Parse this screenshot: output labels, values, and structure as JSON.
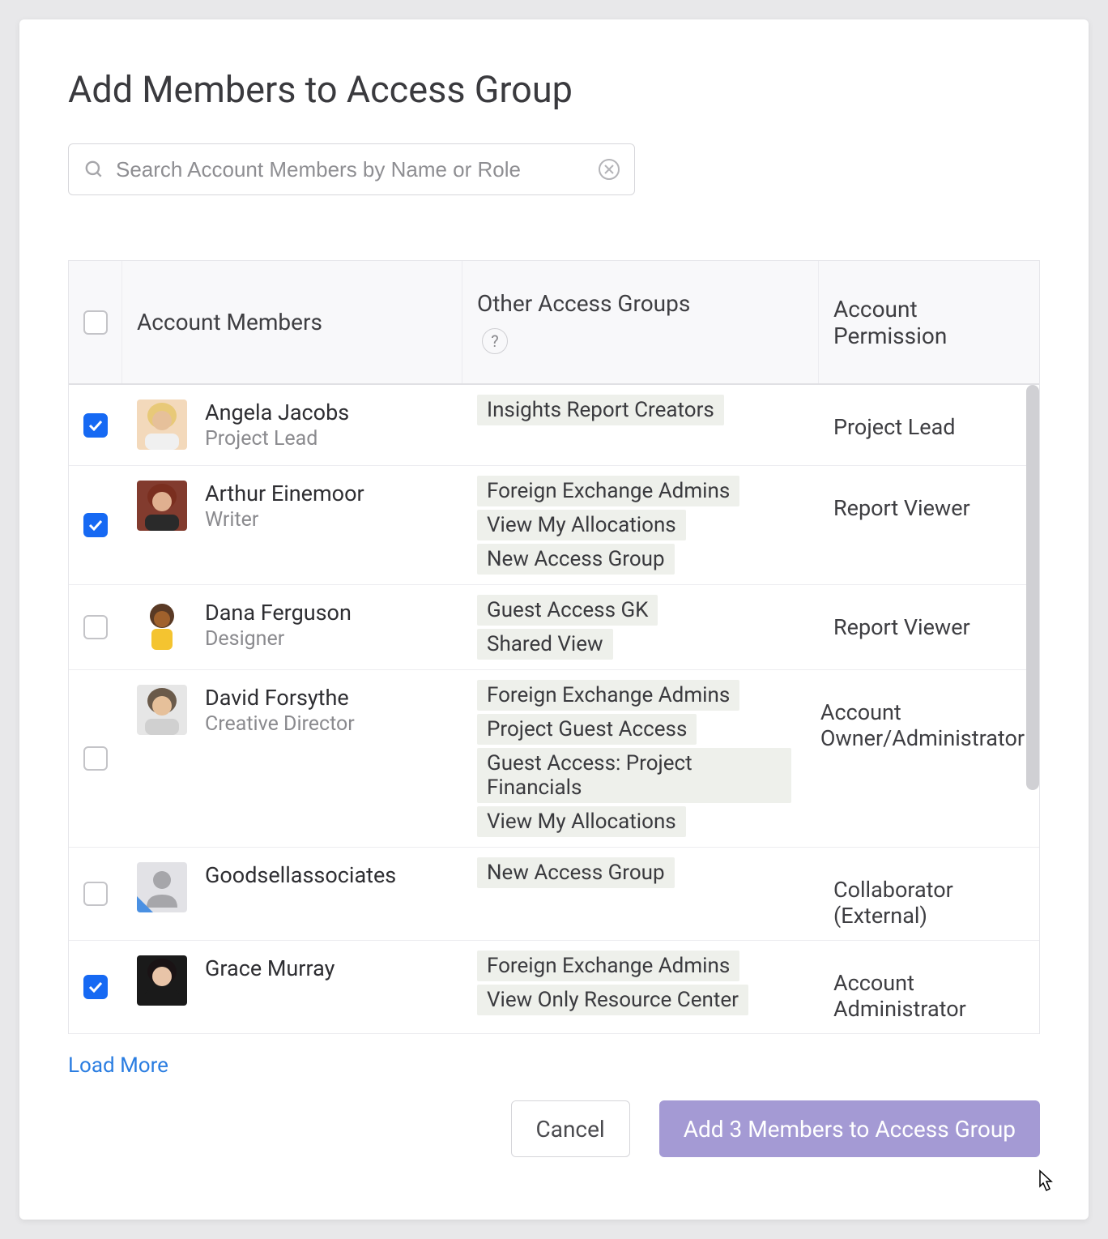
{
  "title": "Add Members to Access Group",
  "search": {
    "placeholder": "Search Account Members by Name or Role"
  },
  "columns": {
    "members": "Account Members",
    "other_groups": "Other Access Groups",
    "permission": "Account Permission"
  },
  "members": [
    {
      "checked": true,
      "name": "Angela Jacobs",
      "role": "Project Lead",
      "groups": [
        "Insights Report Creators"
      ],
      "permission": "Project Lead",
      "avatar_bg": "#f3d9bb",
      "avatar_style": "photo-blonde"
    },
    {
      "checked": true,
      "name": "Arthur Einemoor",
      "role": "Writer",
      "groups": [
        "Foreign Exchange Admins",
        "View My Allocations",
        "New Access Group"
      ],
      "permission": "Report Viewer",
      "avatar_bg": "#823b2e",
      "avatar_style": "photo-brown"
    },
    {
      "checked": false,
      "name": "Dana Ferguson",
      "role": "Designer",
      "groups": [
        "Guest Access GK",
        "Shared View"
      ],
      "permission": "Report Viewer",
      "avatar_bg": "#ffffff",
      "avatar_style": "illustration"
    },
    {
      "checked": false,
      "name": "David Forsythe",
      "role": "Creative Director",
      "groups": [
        "Foreign Exchange Admins",
        "Project Guest Access",
        "Guest Access: Project Financials",
        "View My Allocations"
      ],
      "permission": "Account Owner/Administrator",
      "avatar_bg": "#e6e6e6",
      "avatar_style": "photo-grey"
    },
    {
      "checked": false,
      "name": "Goodsellassociates",
      "role": "",
      "groups": [
        "New Access Group"
      ],
      "permission": "Collaborator (External)",
      "avatar_bg": "#e2e2e6",
      "avatar_style": "placeholder"
    },
    {
      "checked": true,
      "name": "Grace Murray",
      "role": "",
      "groups": [
        "Foreign Exchange Admins",
        "View Only Resource Center"
      ],
      "permission": "Account Administrator",
      "avatar_bg": "#1a1a1a",
      "avatar_style": "photo-dark"
    }
  ],
  "load_more": "Load More",
  "buttons": {
    "cancel": "Cancel",
    "add": "Add 3 Members to Access Group"
  }
}
